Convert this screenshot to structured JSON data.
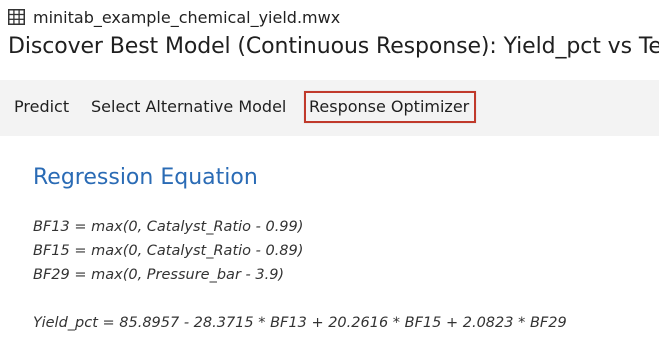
{
  "file": {
    "icon": "spreadsheet-grid-icon",
    "name": "minitab_example_chemical_yield.mwx"
  },
  "analysis": {
    "title": "Discover Best Model (Continuous Response): Yield_pct vs Te"
  },
  "toolbar": {
    "predict_label": "Predict",
    "alternative_label": "Select Alternative Model",
    "optimizer_label": "Response Optimizer",
    "highlight_color": "#c0392b"
  },
  "content": {
    "heading": "Regression Equation",
    "heading_color": "#2a6bb5",
    "basis_functions": [
      "BF13 = max(0, Catalyst_Ratio - 0.99)",
      "BF15 = max(0, Catalyst_Ratio - 0.89)",
      "BF29 = max(0, Pressure_bar - 3.9)"
    ],
    "equation": "Yield_pct = 85.8957 - 28.3715 * BF13 + 20.2616 * BF15 + 2.0823 * BF29"
  }
}
